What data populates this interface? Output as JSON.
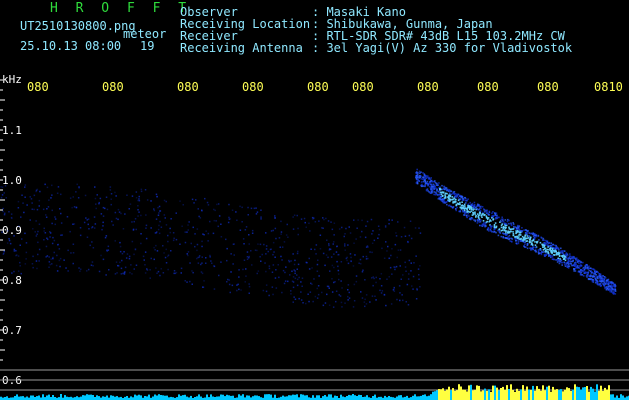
{
  "header": {
    "brand": "H R O F F T",
    "filename": "UT2510130800.png",
    "meteor_label": "meteor",
    "datetime": "25.10.13 08:00",
    "count": "19",
    "info_labels": [
      "Observer",
      "Receiving Location",
      "Receiver",
      "Receiving Antenna"
    ],
    "info_values": [
      ": Masaki Kano",
      ": Shibukawa, Gunma, Japan",
      ": RTL-SDR SDR# 43dB L15 103.2MHz CW",
      ": 3el Yagi(V) Az 330 for Vladivostok"
    ]
  },
  "axis": {
    "y_unit": "kHz",
    "y_ticks": [
      "1.1",
      "1.0",
      "0.9",
      "0.8",
      "0.7",
      "0.6"
    ],
    "x_ticks": [
      "080",
      "080",
      "080",
      "080",
      "080",
      "080",
      "080",
      "080",
      "080",
      "0810"
    ]
  },
  "colors": {
    "background": "#000000",
    "brand": "#2fdc3c",
    "header_text": "#8fe8ff",
    "x_tick": "#ffff55",
    "noise": "#1030d0",
    "echo_core": "#5fd0ff",
    "bottom_bar": "#00c8ff",
    "bottom_bar_burst": "#ffff40"
  }
}
